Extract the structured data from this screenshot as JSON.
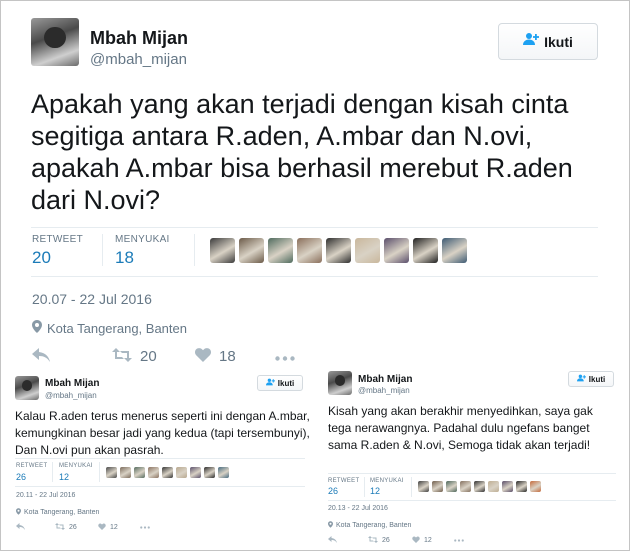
{
  "main": {
    "name": "Mbah Mijan",
    "handle": "@mbah_mijan",
    "follow_label": "Ikuti",
    "text": "Apakah yang akan terjadi dengan kisah cinta segitiga antara R.aden, A.mbar dan N.ovi, apakah A.mbar bisa berhasil merebut R.aden dari N.ovi?",
    "retweet_label": "RETWEET",
    "retweet_count": "20",
    "like_label": "MENYUKAI",
    "like_count": "18",
    "datetime": "20.07 - 22 Jul 2016",
    "location": "Kota Tangerang, Banten",
    "action_retweets": "20",
    "action_likes": "18"
  },
  "left_tweet": {
    "name": "Mbah Mijan",
    "handle": "@mbah_mijan",
    "follow_label": "Ikuti",
    "text": "Kalau R.aden terus menerus seperti ini dengan A.mbar, kemungkinan besar jadi yang kedua (tapi tersembunyi), Dan N.ovi pun akan pasrah.",
    "retweet_label": "RETWEET",
    "retweet_count": "26",
    "like_label": "MENYUKAI",
    "like_count": "12",
    "datetime": "20.11 - 22 Jul 2016",
    "location": "Kota Tangerang, Banten",
    "action_retweets": "26",
    "action_likes": "12"
  },
  "right_tweet": {
    "name": "Mbah Mijan",
    "handle": "@mbah_mijan",
    "follow_label": "Ikuti",
    "text": "Kisah yang akan berakhir menyedihkan, saya gak tega nerawangnya. Padahal dulu ngefans banget sama R.aden & N.ovi, Semoga tidak akan terjadi!",
    "retweet_label": "RETWEET",
    "retweet_count": "26",
    "like_label": "MENYUKAI",
    "like_count": "12",
    "datetime": "20.13 - 22 Jul 2016",
    "location": "Kota Tangerang, Banten",
    "action_retweets": "26",
    "action_likes": "12"
  },
  "icons": {
    "follow": "person-plus-icon",
    "reply": "reply-icon",
    "retweet": "retweet-icon",
    "like": "heart-icon",
    "more": "more-dots-icon",
    "location": "map-pin-icon"
  },
  "colors": {
    "accent": "#1da1f2",
    "stat_value": "#1b7bb8",
    "muted": "#657786",
    "icon_gray": "#aab8c2"
  },
  "liker_colors_main": [
    "#3b3b3b",
    "#6b5a48",
    "#4f6b5e",
    "#8a6f5b",
    "#2e2e2e",
    "#c9b79c",
    "#5a4e6b",
    "#1f1f1f",
    "#3d5a73"
  ],
  "liker_colors_left": [
    "#4a4a4a",
    "#7a6a5a",
    "#556b5e",
    "#8a7260",
    "#333333",
    "#b8a88f",
    "#5a506b",
    "#2a2a2a",
    "#476b80"
  ],
  "liker_colors_right": [
    "#3f3f3f",
    "#6e5c4a",
    "#4c665a",
    "#84705e",
    "#2f2f2f",
    "#bfae93",
    "#574b66",
    "#262626",
    "#c56a3a"
  ]
}
